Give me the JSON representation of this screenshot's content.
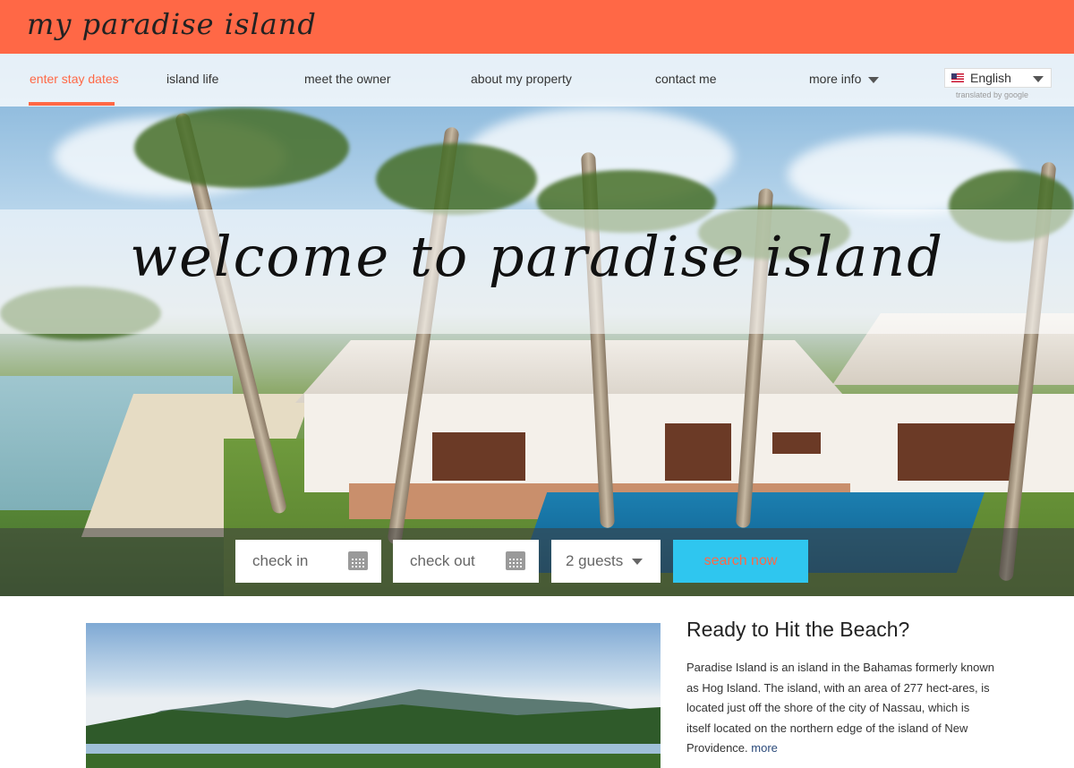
{
  "header": {
    "logo": "my paradise island"
  },
  "nav": {
    "items": [
      {
        "label": "enter stay dates",
        "active": true
      },
      {
        "label": "island life",
        "active": false
      },
      {
        "label": "meet the owner",
        "active": false
      },
      {
        "label": "about my property",
        "active": false
      },
      {
        "label": "contact me",
        "active": false
      },
      {
        "label": "more info",
        "active": false
      }
    ],
    "more_icon": "chevron-down-icon"
  },
  "language": {
    "selected": "English",
    "flag_icon": "us-flag-icon",
    "translated_by": "translated by google"
  },
  "hero": {
    "welcome": "welcome to paradise island"
  },
  "booking": {
    "check_in": "check in",
    "check_out": "check out",
    "guests": "2 guests",
    "search": "search now",
    "calendar_icon": "calendar-icon"
  },
  "content": {
    "title": "Ready to Hit the Beach?",
    "body": "Paradise Island is an island in the Bahamas formerly known as Hog Island. The island, with an area of 277 hect-ares, is located just off the shore of the city of Nassau, which is itself located on the northern edge of the island of New Providence.",
    "more": "more"
  },
  "colors": {
    "brand": "#ff6846",
    "accent": "#2fc6ef"
  }
}
